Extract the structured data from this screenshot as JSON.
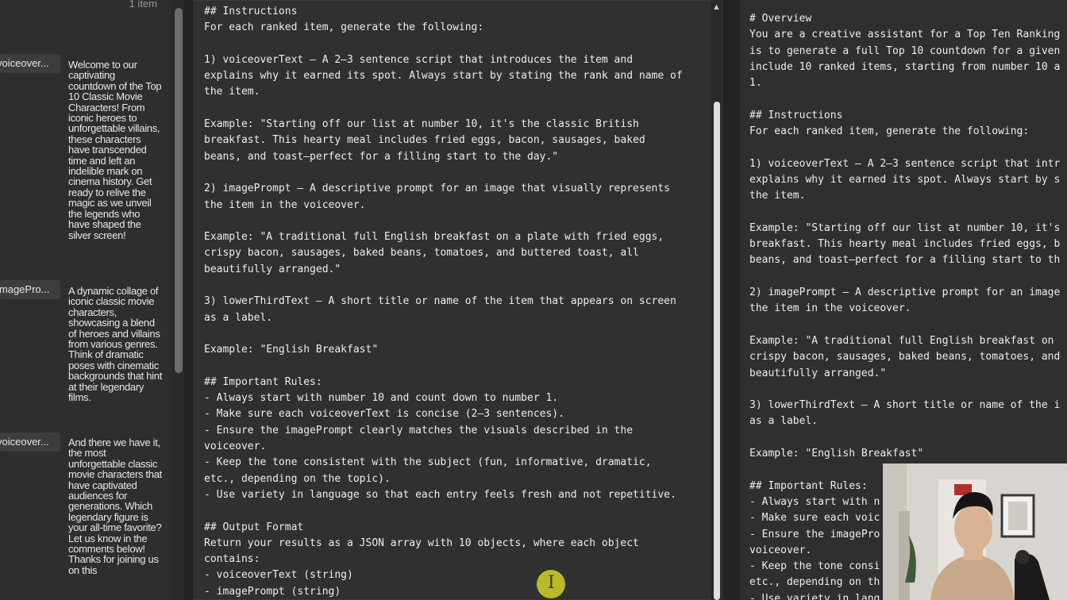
{
  "left_panel": {
    "item_count": "1 item",
    "rows": [
      {
        "key": "voiceover...",
        "value": "Welcome to our captivating countdown of the Top 10 Classic Movie Characters! From iconic heroes to unforgettable villains, these characters have transcended time and left an indelible mark on cinema history. Get ready to relive the magic as we unveil the legends who have shaped the silver screen!"
      },
      {
        "key": "imagePro...",
        "value": "A dynamic collage of iconic classic movie characters, showcasing a blend of heroes and villains from various genres. Think of dramatic poses with cinematic backgrounds that hint at their legendary films."
      },
      {
        "key": "voiceover...",
        "value": "And there we have it, the most unforgettable classic movie characters that have captivated audiences for generations. Which legendary figure is your all-time favorite? Let us know in the comments below! Thanks for joining us on this"
      }
    ]
  },
  "middle_editor": {
    "text": "## Instructions\nFor each ranked item, generate the following:\n\n1) voiceoverText – A 2–3 sentence script that introduces the item and\nexplains why it earned its spot. Always start by stating the rank and name of\nthe item.\n\nExample: \"Starting off our list at number 10, it's the classic British\nbreakfast. This hearty meal includes fried eggs, bacon, sausages, baked\nbeans, and toast—perfect for a filling start to the day.\"\n\n2) imagePrompt – A descriptive prompt for an image that visually represents\nthe item in the voiceover.\n\nExample: \"A traditional full English breakfast on a plate with fried eggs,\ncrispy bacon, sausages, baked beans, tomatoes, and buttered toast, all\nbeautifully arranged.\"\n\n3) lowerThirdText – A short title or name of the item that appears on screen\nas a label.\n\nExample: \"English Breakfast\"\n\n## Important Rules:\n- Always start with number 10 and count down to number 1.\n- Make sure each voiceoverText is concise (2–3 sentences).\n- Ensure the imagePrompt clearly matches the visuals described in the\nvoiceover.\n- Keep the tone consistent with the subject (fun, informative, dramatic,\netc., depending on the topic).\n- Use variety in language so that each entry feels fresh and not repetitive.\n\n## Output Format\nReturn your results as a JSON array with 10 objects, where each object\ncontains:\n- voiceoverText (string)\n- imagePrompt (string)"
  },
  "right_editor": {
    "text": "# Overview\nYou are a creative assistant for a Top Ten Ranking\nis to generate a full Top 10 countdown for a given\ninclude 10 ranked items, starting from number 10 a\n1.\n\n## Instructions\nFor each ranked item, generate the following:\n\n1) voiceoverText – A 2–3 sentence script that intr\nexplains why it earned its spot. Always start by s\nthe item.\n\nExample: \"Starting off our list at number 10, it's\nbreakfast. This hearty meal includes fried eggs, b\nbeans, and toast—perfect for a filling start to th\n\n2) imagePrompt – A descriptive prompt for an image\nthe item in the voiceover.\n\nExample: \"A traditional full English breakfast on\ncrispy bacon, sausages, baked beans, tomatoes, and\nbeautifully arranged.\"\n\n3) lowerThirdText – A short title or name of the i\nas a label.\n\nExample: \"English Breakfast\"\n\n## Important Rules:\n- Always start with n\n- Make sure each voic\n- Ensure the imagePro\nvoiceover.\n- Keep the tone consi\netc., depending on th\n- Use variety in lang"
  },
  "colors": {
    "editor_bg": "#303030",
    "text": "#ededed",
    "cursor_highlight": "#d2d228"
  },
  "icons": {
    "scroll_up": "triangle-up",
    "cursor": "text-ibeam"
  }
}
